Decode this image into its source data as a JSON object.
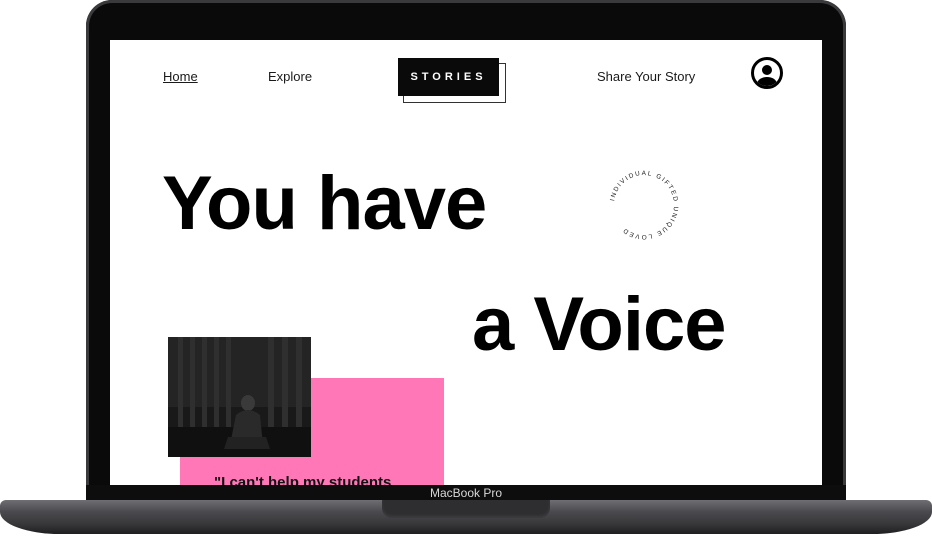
{
  "device": {
    "label": "MacBook Pro"
  },
  "nav": {
    "home": "Home",
    "explore": "Explore",
    "logo": "STORIES",
    "share": "Share Your Story",
    "profile_icon": "user-circle-icon"
  },
  "hero": {
    "line1": "You have",
    "line2": "a Voice"
  },
  "badge": {
    "text": "INDIVIDUAL GIFTED UNIQUE LOVED"
  },
  "feature": {
    "quote": "\"I can't help my students"
  },
  "colors": {
    "accent_pink": "#ff77b6",
    "text": "#000000",
    "bezel": "#0a0a0a"
  }
}
